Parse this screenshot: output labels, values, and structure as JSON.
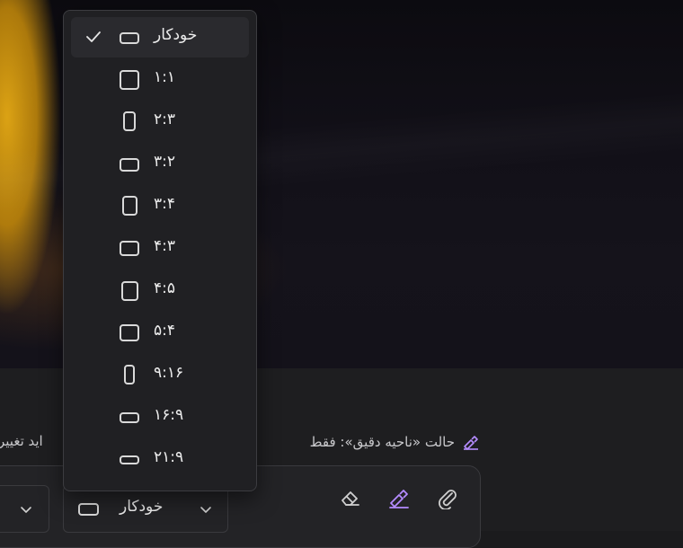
{
  "hint": {
    "text": "حالت «ناحیه دقیق»: فقط",
    "continuation": "اید تغییر"
  },
  "aspect_menu": {
    "selected": "خودکار",
    "items": [
      {
        "label": "خودکار",
        "shape": "landscape-wide",
        "checked": true
      },
      {
        "label": "۱:۱",
        "shape": "square"
      },
      {
        "label": "۲:۳",
        "shape": "portrait"
      },
      {
        "label": "۳:۲",
        "shape": "landscape"
      },
      {
        "label": "۳:۴",
        "shape": "portrait-mild"
      },
      {
        "label": "۴:۳",
        "shape": "landscape-mild"
      },
      {
        "label": "۴:۵",
        "shape": "portrait-mild"
      },
      {
        "label": "۵:۴",
        "shape": "landscape-mild"
      },
      {
        "label": "۹:۱۶",
        "shape": "portrait-tall"
      },
      {
        "label": "۱۶:۹",
        "shape": "landscape-wide"
      },
      {
        "label": "۲۱:۹",
        "shape": "landscape-ultrawide"
      }
    ]
  },
  "toolbar": {
    "ratio_select_label": "خودکار",
    "icons": [
      "eraser-icon",
      "pen-icon",
      "paperclip-icon"
    ]
  },
  "colors": {
    "accent": "#b58cff",
    "menu_bg": "#202023",
    "selected_bg": "#2a2a2e"
  }
}
